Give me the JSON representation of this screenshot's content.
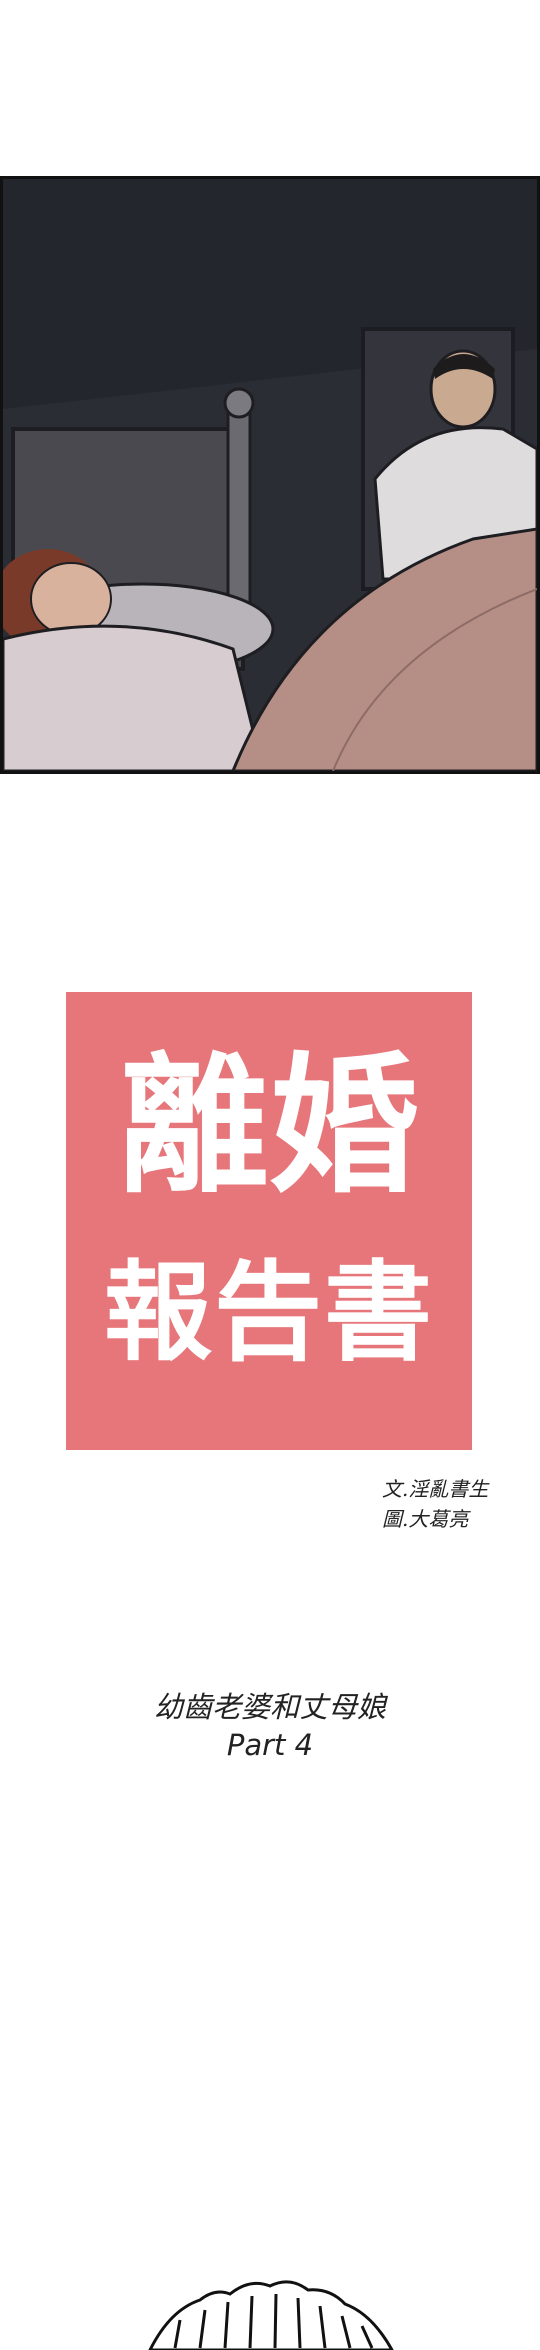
{
  "title": {
    "line1": "離婚",
    "line2": "報告書"
  },
  "credits": {
    "writer": "文.淫亂書生",
    "artist": "圖.大葛亮"
  },
  "episode": {
    "subtitle": "幼齒老婆和丈母娘",
    "part": "Part 4"
  },
  "colors": {
    "title_block": "#e7767a",
    "panel_border": "#111111",
    "background": "#ffffff"
  }
}
